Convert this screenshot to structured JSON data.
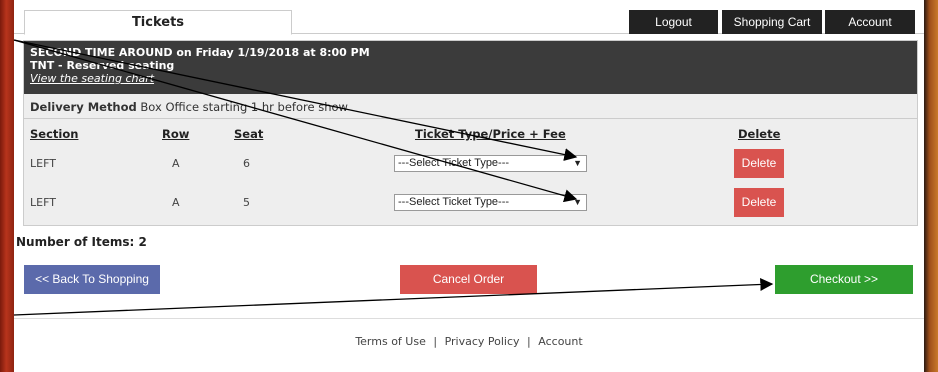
{
  "tabs": {
    "tickets": "Tickets"
  },
  "topnav": {
    "logout": "Logout",
    "cart": "Shopping Cart",
    "account": "Account"
  },
  "event": {
    "title": "SECOND TIME AROUND on Friday 1/19/2018 at 8:00 PM",
    "venue": "TNT - Reserved seating",
    "seating_link": "View the seating chart"
  },
  "delivery": {
    "label": "Delivery Method",
    "value": "Box Office starting 1 hr before show"
  },
  "table": {
    "headers": {
      "section": "Section",
      "row": "Row",
      "seat": "Seat",
      "ticket_type": "Ticket Type/Price + Fee",
      "delete": "Delete"
    },
    "rows": [
      {
        "section": "LEFT",
        "row": "A",
        "seat": "6",
        "select": "---Select Ticket Type---",
        "delete": "Delete"
      },
      {
        "section": "LEFT",
        "row": "A",
        "seat": "5",
        "select": "---Select Ticket Type---",
        "delete": "Delete"
      }
    ]
  },
  "summary": {
    "items": "Number of Items: 2"
  },
  "actions": {
    "back": "<< Back To Shopping",
    "cancel": "Cancel Order",
    "checkout": "Checkout >>"
  },
  "footer": {
    "terms": "Terms of Use",
    "sep1": "|",
    "privacy": "Privacy Policy",
    "sep2": "|",
    "account": "Account"
  },
  "colors": {
    "header_dark": "#3b3b3b",
    "delete_red": "#d9534f",
    "back_blue": "#5b6aab",
    "cancel_red": "#d9534f",
    "checkout_green": "#2e9e2e"
  }
}
